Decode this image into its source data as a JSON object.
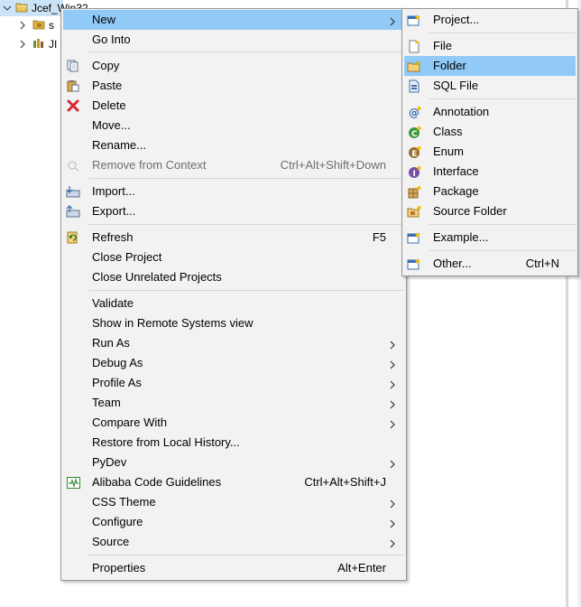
{
  "tree": {
    "items": [
      {
        "label": "Jcef_Win32"
      },
      {
        "label": "s"
      },
      {
        "label": "JI"
      }
    ]
  },
  "context_menu": {
    "items": [
      {
        "label": "New"
      },
      {
        "label": "Go Into"
      },
      {
        "label": "Copy"
      },
      {
        "label": "Paste"
      },
      {
        "label": "Delete"
      },
      {
        "label": "Move..."
      },
      {
        "label": "Rename..."
      },
      {
        "label": "Remove from Context",
        "shortcut": "Ctrl+Alt+Shift+Down"
      },
      {
        "label": "Import..."
      },
      {
        "label": "Export..."
      },
      {
        "label": "Refresh",
        "shortcut": "F5"
      },
      {
        "label": "Close Project"
      },
      {
        "label": "Close Unrelated Projects"
      },
      {
        "label": "Validate"
      },
      {
        "label": "Show in Remote Systems view"
      },
      {
        "label": "Run As"
      },
      {
        "label": "Debug As"
      },
      {
        "label": "Profile As"
      },
      {
        "label": "Team"
      },
      {
        "label": "Compare With"
      },
      {
        "label": "Restore from Local History..."
      },
      {
        "label": "PyDev"
      },
      {
        "label": "Alibaba Code Guidelines",
        "shortcut": "Ctrl+Alt+Shift+J"
      },
      {
        "label": "CSS Theme"
      },
      {
        "label": "Configure"
      },
      {
        "label": "Source"
      },
      {
        "label": "Properties",
        "shortcut": "Alt+Enter"
      }
    ]
  },
  "new_submenu": {
    "items": [
      {
        "label": "Project..."
      },
      {
        "label": "File"
      },
      {
        "label": "Folder"
      },
      {
        "label": "SQL File"
      },
      {
        "label": "Annotation"
      },
      {
        "label": "Class"
      },
      {
        "label": "Enum"
      },
      {
        "label": "Interface"
      },
      {
        "label": "Package"
      },
      {
        "label": "Source Folder"
      },
      {
        "label": "Example..."
      },
      {
        "label": "Other...",
        "shortcut": "Ctrl+N"
      }
    ]
  },
  "colors": {
    "highlight": "#91c9f7",
    "menu_bg": "#f2f2f2",
    "disabled_text": "#6d6d6d"
  }
}
